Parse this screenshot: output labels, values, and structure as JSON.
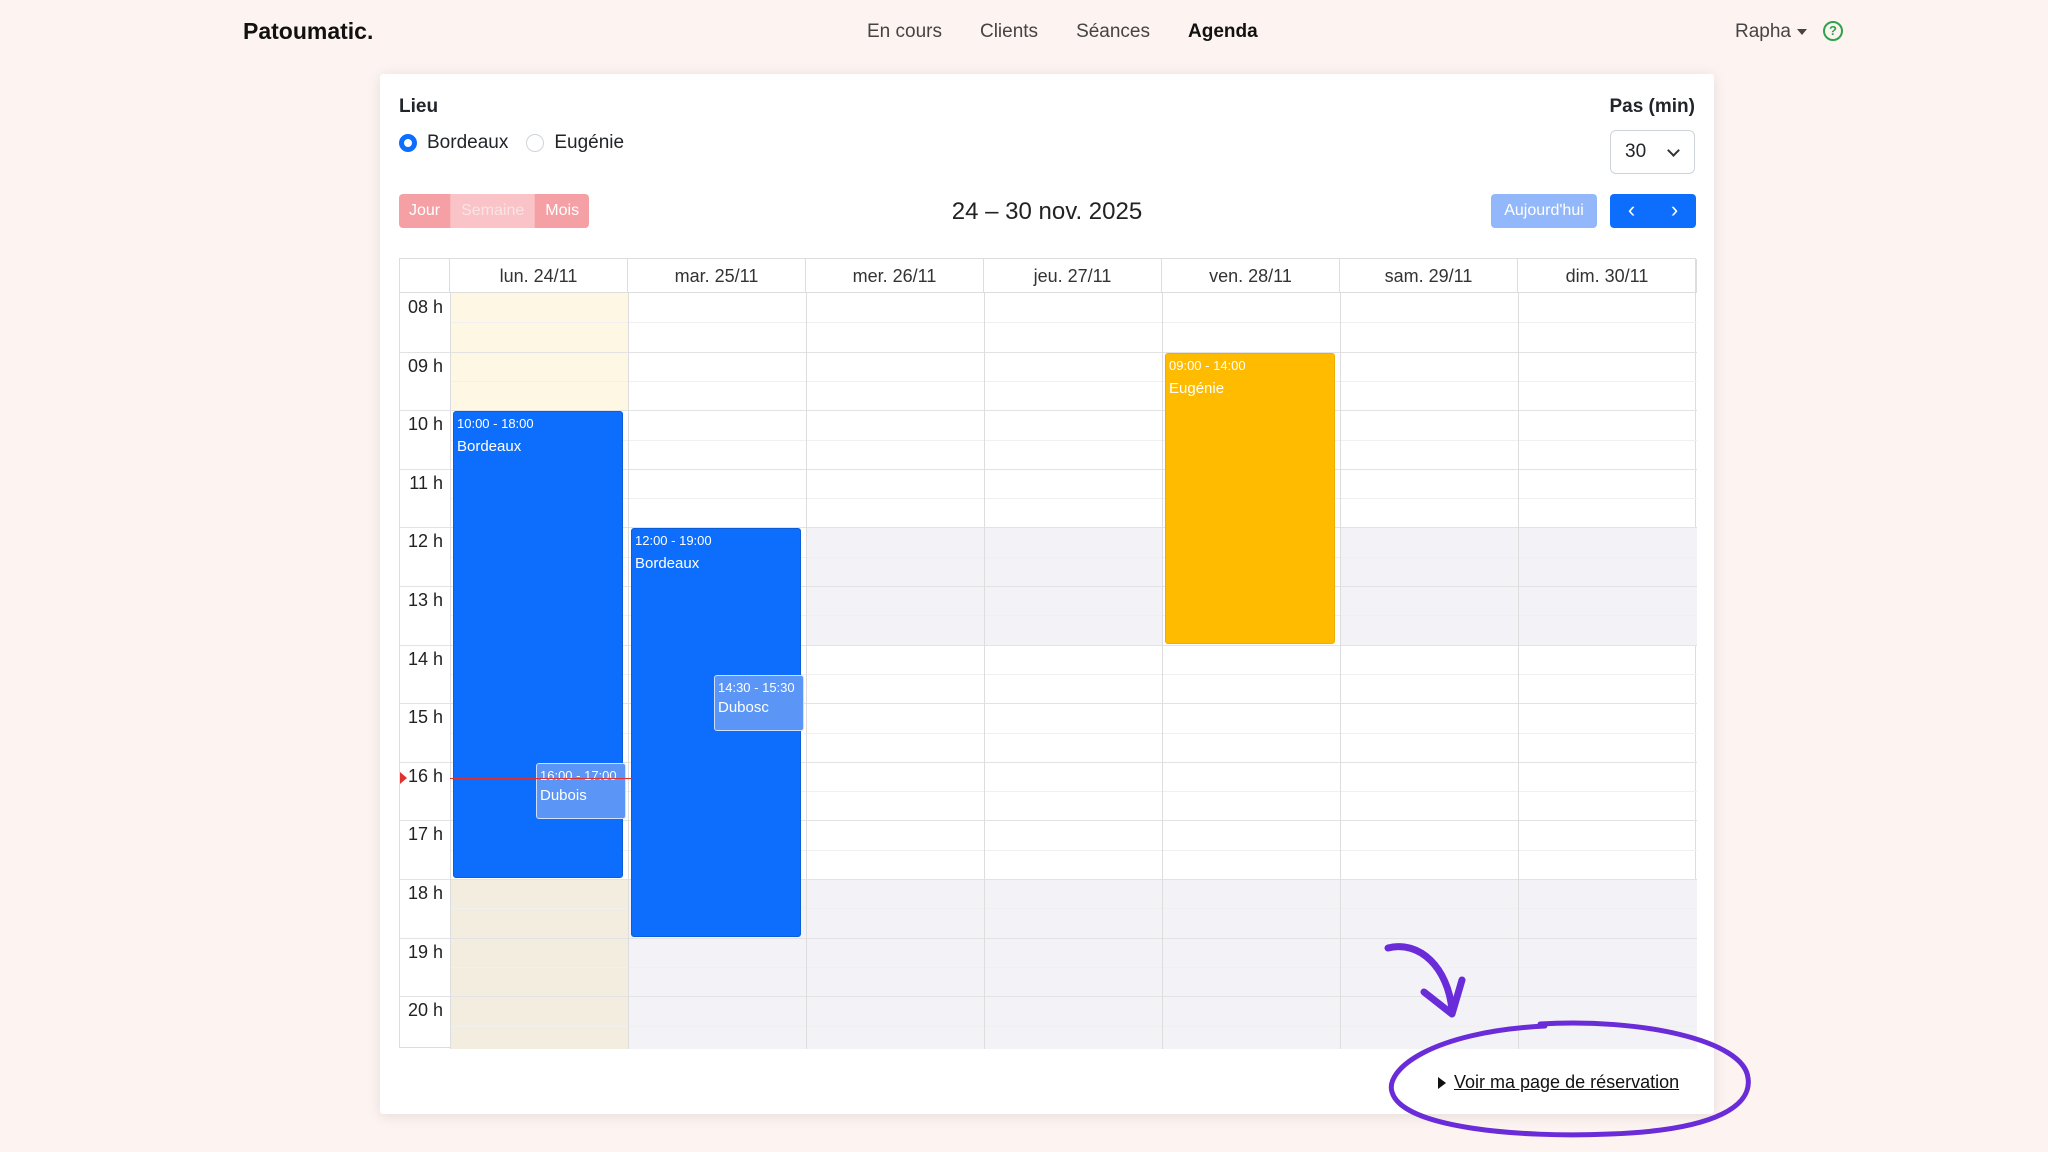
{
  "navbar": {
    "brand": "Patoumatic.",
    "links": [
      "En cours",
      "Clients",
      "Séances",
      "Agenda"
    ],
    "active_link": "Agenda",
    "user": "Rapha",
    "help_icon": "?"
  },
  "filters": {
    "lieu_label": "Lieu",
    "options": [
      "Bordeaux",
      "Eugénie"
    ],
    "selected": "Bordeaux",
    "pas_label": "Pas (min)",
    "pas_value": "30"
  },
  "toolbar": {
    "views": [
      "Jour",
      "Semaine",
      "Mois"
    ],
    "active_view": "Semaine",
    "title": "24 – 30 nov. 2025",
    "today_label": "Aujourd'hui",
    "prev_icon": "‹",
    "next_icon": "›"
  },
  "calendar": {
    "days": [
      "lun. 24/11",
      "mar. 25/11",
      "mer. 26/11",
      "jeu. 27/11",
      "ven. 28/11",
      "sam. 29/11",
      "dim. 30/11"
    ],
    "hours": [
      "08 h",
      "09 h",
      "10 h",
      "11 h",
      "12 h",
      "13 h",
      "14 h",
      "15 h",
      "16 h",
      "17 h",
      "18 h",
      "19 h",
      "20 h"
    ],
    "events": [
      {
        "time": "10:00 - 18:00",
        "title": "Bordeaux",
        "day": 0,
        "start": 10,
        "end": 18,
        "color": "#0d6efd"
      },
      {
        "time": "12:00 - 19:00",
        "title": "Bordeaux",
        "day": 1,
        "start": 12,
        "end": 19,
        "color": "#0d6efd"
      },
      {
        "time": "09:00 - 14:00",
        "title": "Eugénie",
        "day": 4,
        "start": 9,
        "end": 14,
        "color": "#ffbb00"
      },
      {
        "time": "14:30 - 15:30",
        "title": "Dubosc",
        "day": 1,
        "start": 14.5,
        "end": 15.5,
        "color": "#5b95f5"
      },
      {
        "time": "16:00 - 17:00",
        "title": "Dubois",
        "day": 0,
        "start": 16,
        "end": 17,
        "color": "#5b95f5"
      }
    ]
  },
  "reservation_link": "Voir ma page de réservation"
}
